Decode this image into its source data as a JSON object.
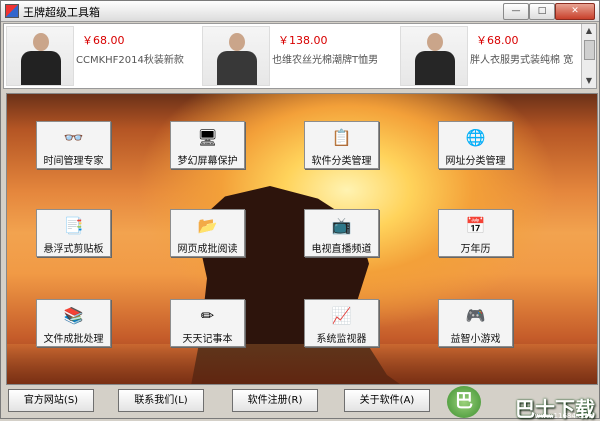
{
  "window": {
    "title": "王牌超级工具箱",
    "controls": {
      "minimize": "—",
      "maximize": "□",
      "close": "✕"
    }
  },
  "ads": [
    {
      "price": "￥68.00",
      "desc": "CCMKHF2014秋装新款"
    },
    {
      "price": "￥138.00",
      "desc": "也维农丝光棉潮牌T恤男"
    },
    {
      "price": "￥68.00",
      "desc": "胖人衣服男式装纯棉 宽"
    }
  ],
  "ad_scroll": {
    "up": "▲",
    "down": "▼"
  },
  "apps": [
    {
      "label": "时间管理专家",
      "icon": "👓"
    },
    {
      "label": "梦幻屏幕保护",
      "icon": "🖥"
    },
    {
      "label": "软件分类管理",
      "icon": "📋"
    },
    {
      "label": "网址分类管理",
      "icon": "🌐"
    },
    {
      "label": "悬浮式剪贴板",
      "icon": "📑"
    },
    {
      "label": "网页成批阅读",
      "icon": "📂"
    },
    {
      "label": "电视直播频道",
      "icon": "📺"
    },
    {
      "label": "万年历",
      "icon": "📅"
    },
    {
      "label": "文件成批处理",
      "icon": "📚"
    },
    {
      "label": "天天记事本",
      "icon": "✏"
    },
    {
      "label": "系统监视器",
      "icon": "📈"
    },
    {
      "label": "益智小游戏",
      "icon": "🎮"
    }
  ],
  "footer": {
    "official_site": "官方网站(S)",
    "contact_us": "联系我们(L)",
    "software_register": "软件注册(R)",
    "about_software": "关于软件(A)"
  },
  "watermark": {
    "logo_text": "巴",
    "text": "巴士下载",
    "url": "www.11684.com"
  }
}
